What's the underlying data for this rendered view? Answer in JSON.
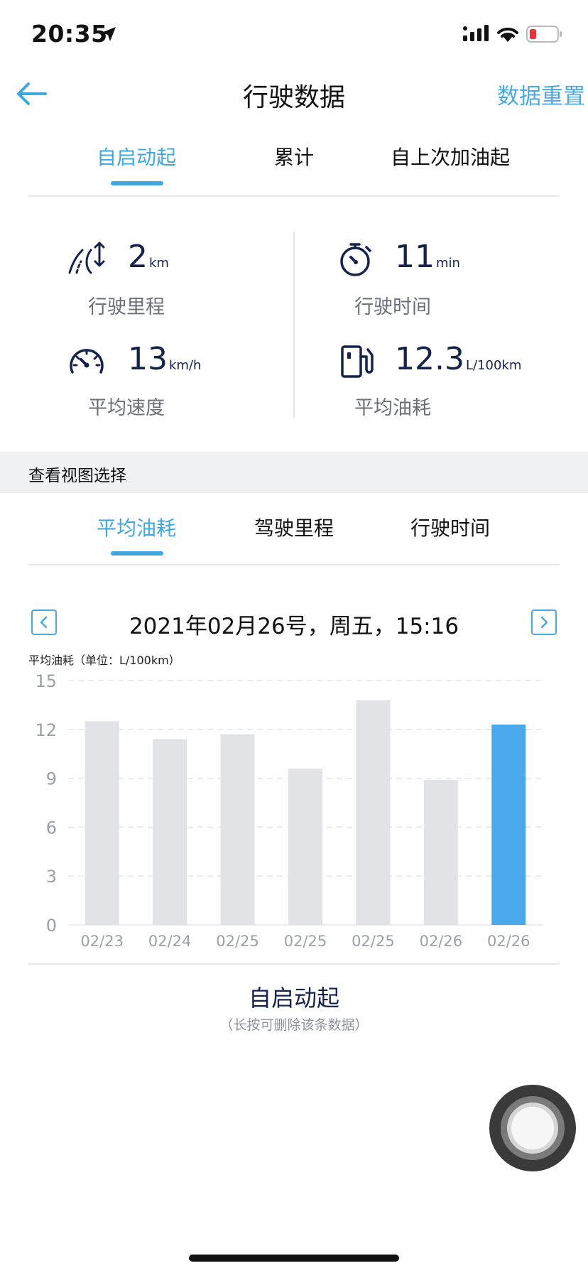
{
  "status_bar": {
    "time": "20:35"
  },
  "nav": {
    "title": "行驶数据",
    "reset_label": "数据重置"
  },
  "tabs": [
    {
      "label": "自启动起",
      "active": true
    },
    {
      "label": "累计",
      "active": false
    },
    {
      "label": "自上次加油起",
      "active": false
    }
  ],
  "stats": {
    "distance": {
      "value": "2",
      "unit": "km",
      "label": "行驶里程"
    },
    "time": {
      "value": "11",
      "unit": "min",
      "label": "行驶时间"
    },
    "speed": {
      "value": "13",
      "unit": "km/h",
      "label": "平均速度"
    },
    "fuel": {
      "value": "12.3",
      "unit": "L/100km",
      "label": "平均油耗"
    }
  },
  "section": {
    "title": "查看视图选择"
  },
  "view_tabs": [
    {
      "label": "平均油耗",
      "active": true
    },
    {
      "label": "驾驶里程",
      "active": false
    },
    {
      "label": "行驶时间",
      "active": false
    }
  ],
  "date_nav": {
    "current": "2021年02月26号，周五，15:16"
  },
  "colors": {
    "accent": "#3fa8df",
    "bar": "#e1e3e7",
    "bar_active": "#4aa9ea",
    "navy": "#15234a"
  },
  "chart_data": {
    "type": "bar",
    "ylabel": "平均油耗（单位：L/100km）",
    "ylim": [
      0,
      15
    ],
    "yticks": [
      0,
      3,
      6,
      9,
      12,
      15
    ],
    "categories": [
      "02/23",
      "02/24",
      "02/25",
      "02/25",
      "02/25",
      "02/26",
      "02/26"
    ],
    "values": [
      12.5,
      11.4,
      11.7,
      9.6,
      13.8,
      8.9,
      12.3
    ],
    "highlight_index": 6,
    "grid": true
  },
  "footer": {
    "title": "自启动起",
    "hint": "（长按可删除该条数据）"
  }
}
